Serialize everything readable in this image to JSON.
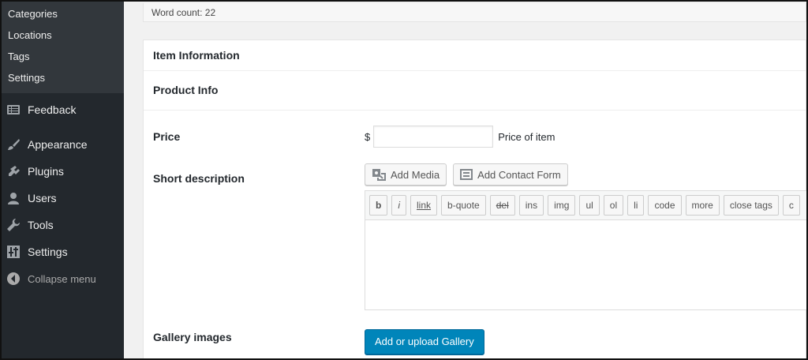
{
  "sidebar": {
    "submenu": [
      "Categories",
      "Locations",
      "Tags",
      "Settings"
    ],
    "menu": [
      {
        "label": "Feedback",
        "icon": "feedback-icon"
      },
      {
        "label": "Appearance",
        "icon": "brush-icon"
      },
      {
        "label": "Plugins",
        "icon": "plugin-icon"
      },
      {
        "label": "Users",
        "icon": "user-icon"
      },
      {
        "label": "Tools",
        "icon": "wrench-icon"
      },
      {
        "label": "Settings",
        "icon": "settings-sliders-icon"
      }
    ],
    "collapse_label": "Collapse menu"
  },
  "editor_status": {
    "word_count": "Word count: 22"
  },
  "item_box": {
    "title": "Item Information",
    "section_title": "Product Info",
    "price": {
      "label": "Price",
      "currency": "$",
      "value": "",
      "placeholder": "",
      "hint": "Price of item"
    },
    "short_description": {
      "label": "Short description",
      "add_media": "Add Media",
      "add_contact_form": "Add Contact Form",
      "quicktags": [
        "b",
        "i",
        "link",
        "b-quote",
        "del",
        "ins",
        "img",
        "ul",
        "ol",
        "li",
        "code",
        "more",
        "close tags",
        "c"
      ],
      "content": ""
    },
    "gallery": {
      "label": "Gallery images",
      "button": "Add or upload Gallery"
    }
  },
  "colors": {
    "sidebar_bg": "#23282d",
    "submenu_bg": "#32373c",
    "primary": "#0085ba"
  }
}
